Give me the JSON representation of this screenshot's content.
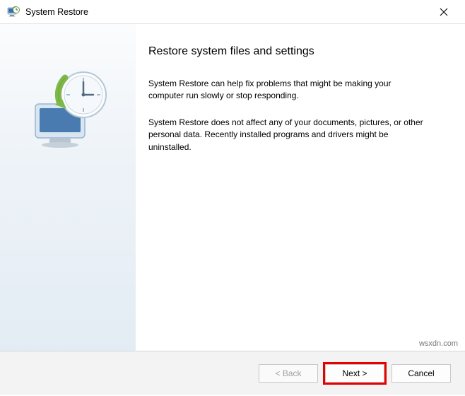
{
  "window": {
    "title": "System Restore"
  },
  "main": {
    "heading": "Restore system files and settings",
    "paragraph1": "System Restore can help fix problems that might be making your computer run slowly or stop responding.",
    "paragraph2": "System Restore does not affect any of your documents, pictures, or other personal data. Recently installed programs and drivers might be uninstalled."
  },
  "buttons": {
    "back": "< Back",
    "next": "Next >",
    "cancel": "Cancel"
  },
  "watermark": "wsxdn.com"
}
